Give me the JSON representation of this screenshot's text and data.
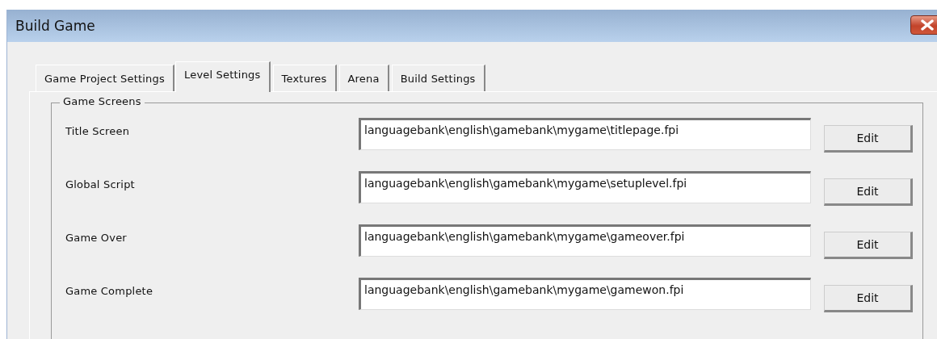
{
  "window": {
    "title": "Build Game"
  },
  "tabs": [
    {
      "label": "Game Project Settings",
      "selected": false
    },
    {
      "label": "Level Settings",
      "selected": true
    },
    {
      "label": "Textures",
      "selected": false
    },
    {
      "label": "Arena",
      "selected": false
    },
    {
      "label": "Build Settings",
      "selected": false
    }
  ],
  "group": {
    "title": "Game Screens",
    "rows": [
      {
        "label": "Title Screen",
        "value": "languagebank\\english\\gamebank\\mygame\\titlepage.fpi",
        "button": "Edit"
      },
      {
        "label": "Global Script",
        "value": "languagebank\\english\\gamebank\\mygame\\setuplevel.fpi",
        "button": "Edit"
      },
      {
        "label": "Game Over",
        "value": "languagebank\\english\\gamebank\\mygame\\gameover.fpi",
        "button": "Edit"
      },
      {
        "label": "Game Complete",
        "value": "languagebank\\english\\gamebank\\mygame\\gamewon.fpi",
        "button": "Edit"
      }
    ]
  }
}
